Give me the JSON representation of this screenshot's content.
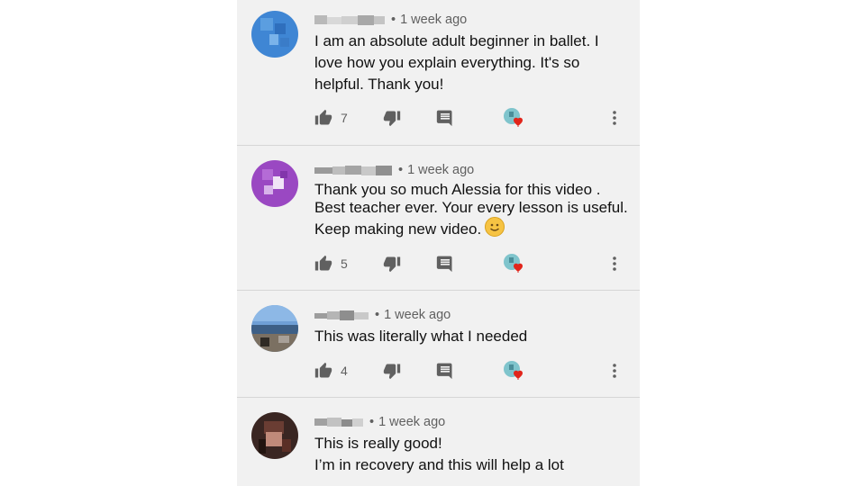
{
  "comments": [
    {
      "time": "1 week ago",
      "text_lines": [
        "I am an absolute adult beginner in ballet.  I",
        "love how you explain everything.   It's so",
        "helpful.  Thank you!"
      ],
      "likes": "7"
    },
    {
      "time": "1 week ago",
      "text_lines": [
        "Thank you so much Alessia for this video .",
        "Best teacher ever. Your every lesson is useful.",
        "Keep making new video."
      ],
      "trailing_emoji": "smiling-face-emoji",
      "likes": "5"
    },
    {
      "time": "1 week ago",
      "text_lines": [
        "This was literally what I needed"
      ],
      "likes": "4"
    },
    {
      "time": "1 week ago",
      "text_lines": [
        "This is really good!",
        "I’m in recovery and this will help a lot"
      ]
    }
  ],
  "separator": "•",
  "icons": {
    "like": "thumb-up-icon",
    "dislike": "thumb-down-icon",
    "reply": "reply-comment-icon",
    "heart": "creator-heart-icon",
    "more": "more-vertical-icon"
  },
  "colors": {
    "panel_bg": "#f1f1f1",
    "text": "#111111",
    "meta": "#606060",
    "heart": "#e1251b"
  }
}
